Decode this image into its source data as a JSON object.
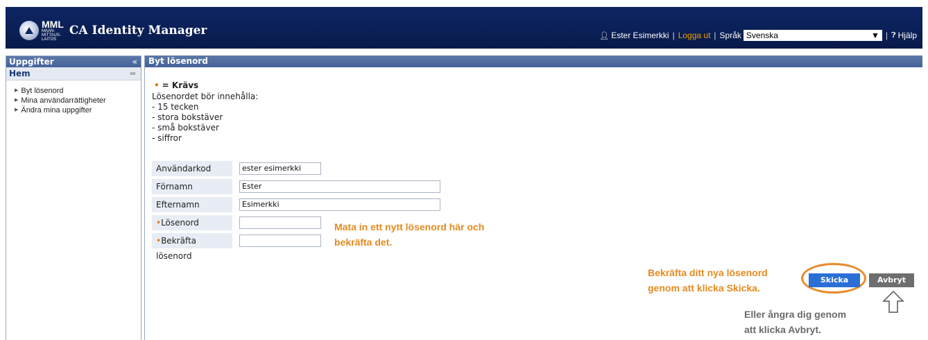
{
  "header": {
    "logo_big": "MML",
    "logo_small": [
      "MAAN-",
      "MITTAUS-",
      "LAITOS"
    ],
    "app_title": "CA Identity Manager",
    "user_name": "Ester Esimerkki",
    "logout_label": "Logga ut",
    "language_label": "Språk",
    "language_value": "Svenska",
    "help_label": "Hjälp",
    "user_icon": "user-icon",
    "help_icon": "help-icon"
  },
  "sidebar": {
    "title": "Uppgifter",
    "collapse_glyph": "«",
    "section": "Hem",
    "section_glyph": "═",
    "items": [
      {
        "label": "Byt lösenord"
      },
      {
        "label": "Mina användarrättigheter"
      },
      {
        "label": "Ändra mina uppgifter"
      }
    ]
  },
  "main": {
    "title": "Byt lösenord",
    "required_legend": "= Krävs",
    "rules_intro": "Lösenordet bör innehålla:",
    "rules": [
      "- 15 tecken",
      "- stora bokstäver",
      "- små bokstäver",
      "- siffror"
    ],
    "form": {
      "username_label": "Användarkod",
      "username_value": "ester esimerkki",
      "firstname_label": "Förnamn",
      "firstname_value": "Ester",
      "lastname_label": "Efternamn",
      "lastname_value": "Esimerkki",
      "password_label": "Lösenord",
      "password_value": "",
      "confirm_label": "Bekräfta lösenord",
      "confirm_value": ""
    },
    "submit_label": "Skicka",
    "cancel_label": "Avbryt"
  },
  "annotations": {
    "password_note": [
      "Mata in ett nytt lösenord här och",
      "bekräfta det."
    ],
    "confirm_note": [
      "Bekräfta ditt nya lösenord",
      "genom att klicka Skicka."
    ],
    "cancel_note": [
      "Eller ångra dig genom",
      "att klicka Avbryt."
    ]
  },
  "colors": {
    "header_bg": "#0d2563",
    "panel_header": "#4e6ba0",
    "accent_orange": "#e58a1f",
    "submit_blue": "#2a6fd6",
    "cancel_gray": "#6e6e6e"
  }
}
